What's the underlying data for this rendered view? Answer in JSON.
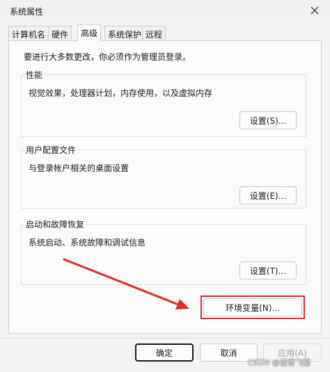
{
  "window": {
    "title": "系统属性",
    "close_glyph": "✕"
  },
  "tabs": [
    {
      "label": "计算机名"
    },
    {
      "label": "硬件"
    },
    {
      "label": "高级",
      "active": true
    },
    {
      "label": "系统保护"
    },
    {
      "label": "远程"
    }
  ],
  "admin_note": "要进行大多数更改，你必须作为管理员登录。",
  "performance": {
    "title": "性能",
    "description": "视觉效果，处理器计划，内存使用，以及虚拟内存",
    "button_label": "设置(S)..."
  },
  "user_profiles": {
    "title": "用户配置文件",
    "description": "与登录帐户相关的桌面设置",
    "button_label": "设置(E)..."
  },
  "startup_recovery": {
    "title": "启动和故障恢复",
    "description": "系统启动、系统故障和调试信息",
    "button_label": "设置(T)..."
  },
  "env_vars": {
    "button_label": "环境变量(N)..."
  },
  "footer": {
    "ok_label": "确定",
    "cancel_label": "取消",
    "apply_label": "应用(A)"
  },
  "watermark": "CSDN @傲雪飞龍",
  "colors": {
    "annotation_red": "#e12b25"
  }
}
